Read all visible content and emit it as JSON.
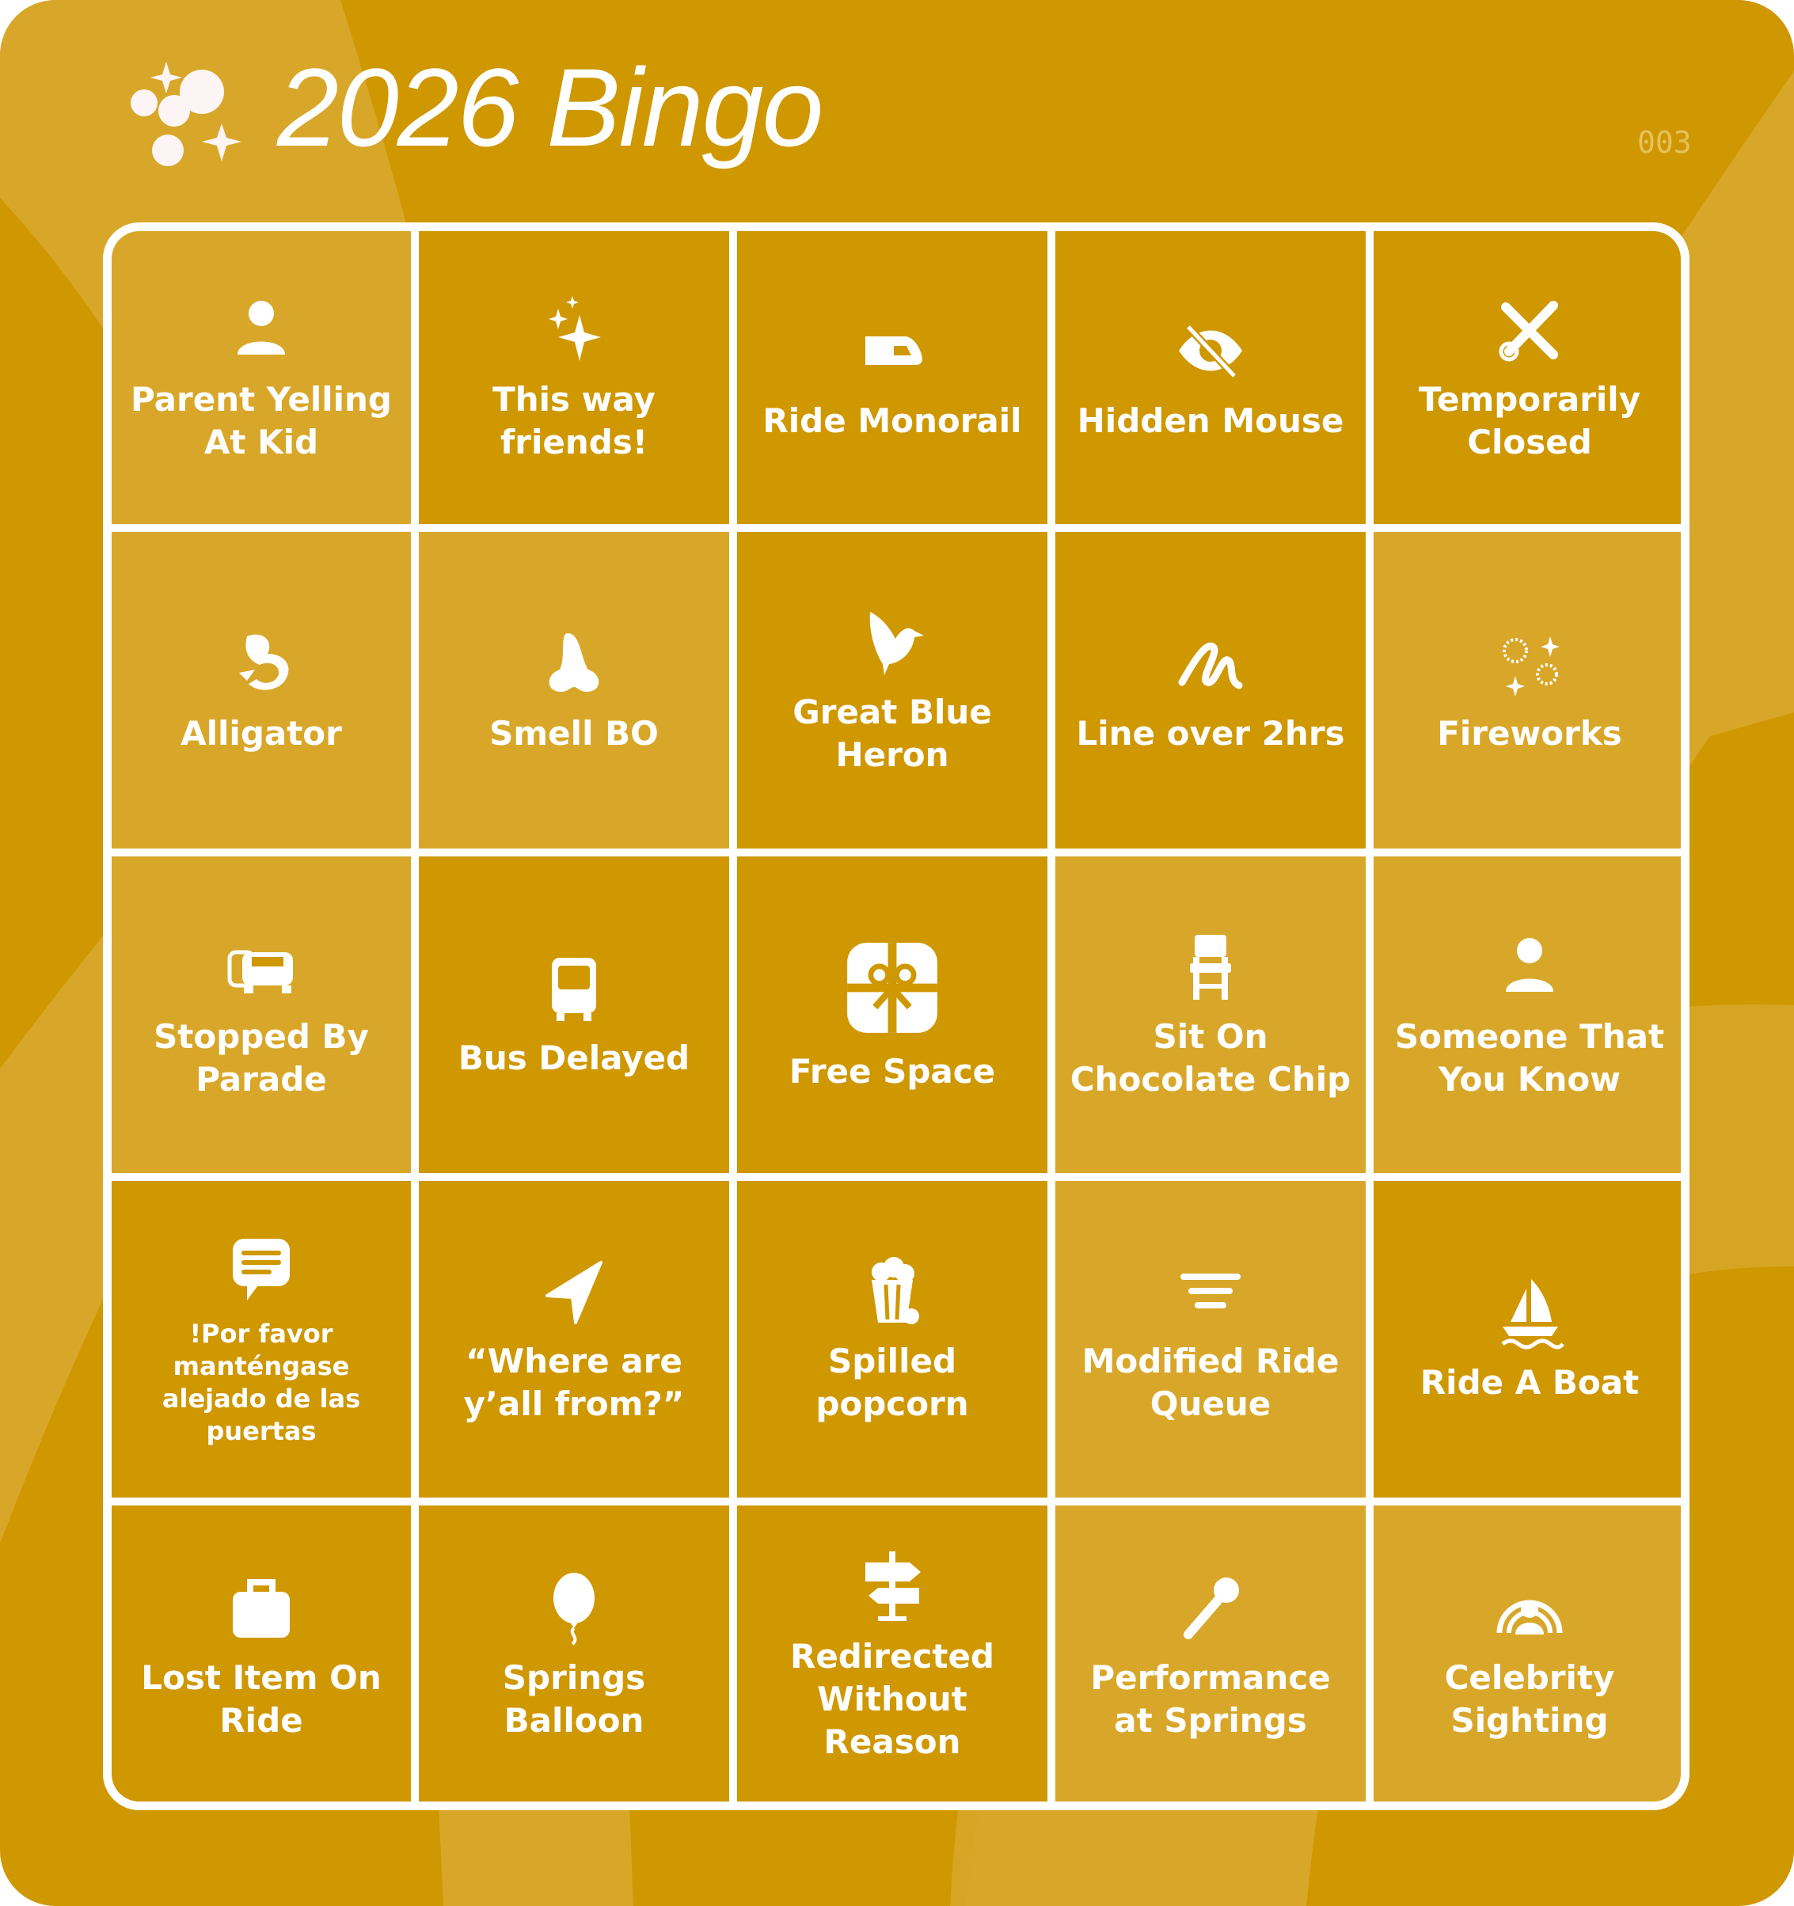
{
  "header": {
    "title": "2026 Bingo",
    "serial": "003",
    "logo_icon": "sparkle-bubbles-icon"
  },
  "colors": {
    "background": "#CF9700",
    "accent_light": "#D8A72A",
    "text": "#FFFFFF",
    "serial": "#E6C15E"
  },
  "cells": [
    {
      "label": "Parent Yelling At Kid",
      "icon": "person-icon",
      "light": true
    },
    {
      "label": "This way friends!",
      "icon": "sparkles-icon",
      "light": false
    },
    {
      "label": "Ride Monorail",
      "icon": "monorail-icon",
      "light": false
    },
    {
      "label": "Hidden Mouse",
      "icon": "eye-slash-icon",
      "light": false
    },
    {
      "label": "Temporarily Closed",
      "icon": "tools-icon",
      "light": false
    },
    {
      "label": "Alligator",
      "icon": "lizard-icon",
      "light": true
    },
    {
      "label": "Smell BO",
      "icon": "nose-icon",
      "light": true
    },
    {
      "label": "Great Blue Heron",
      "icon": "bird-icon",
      "light": false
    },
    {
      "label": "Line over 2hrs",
      "icon": "squiggle-icon",
      "light": false
    },
    {
      "label": "Fireworks",
      "icon": "fireworks-icon",
      "light": true
    },
    {
      "label": "Stopped By Parade",
      "icon": "cars-icon",
      "light": true
    },
    {
      "label": "Bus Delayed",
      "icon": "bus-icon",
      "light": false
    },
    {
      "label": "Free Space",
      "icon": "gift-icon",
      "light": false,
      "free": true
    },
    {
      "label": "Sit On Chocolate Chip",
      "icon": "chair-icon",
      "light": true
    },
    {
      "label": "Someone That You Know",
      "icon": "person-icon",
      "light": true
    },
    {
      "label": "!Por favor manténgase alejado de las puertas",
      "icon": "speech-bubble-icon",
      "light": false,
      "small": true
    },
    {
      "label": "“Where are y’all from?”",
      "icon": "location-arrow-icon",
      "light": false
    },
    {
      "label": "Spilled popcorn",
      "icon": "popcorn-icon",
      "light": false
    },
    {
      "label": "Modified Ride Queue",
      "icon": "text-align-icon",
      "light": true
    },
    {
      "label": "Ride A Boat",
      "icon": "sailboat-icon",
      "light": false
    },
    {
      "label": "Lost Item On Ride",
      "icon": "bag-icon",
      "light": false
    },
    {
      "label": "Springs Balloon",
      "icon": "balloon-icon",
      "light": false
    },
    {
      "label": "Redirected Without Reason",
      "icon": "signpost-icon",
      "light": false
    },
    {
      "label": "Performance at Springs",
      "icon": "microphone-icon",
      "light": true
    },
    {
      "label": "Celebrity Sighting",
      "icon": "broadcast-person-icon",
      "light": true
    }
  ]
}
